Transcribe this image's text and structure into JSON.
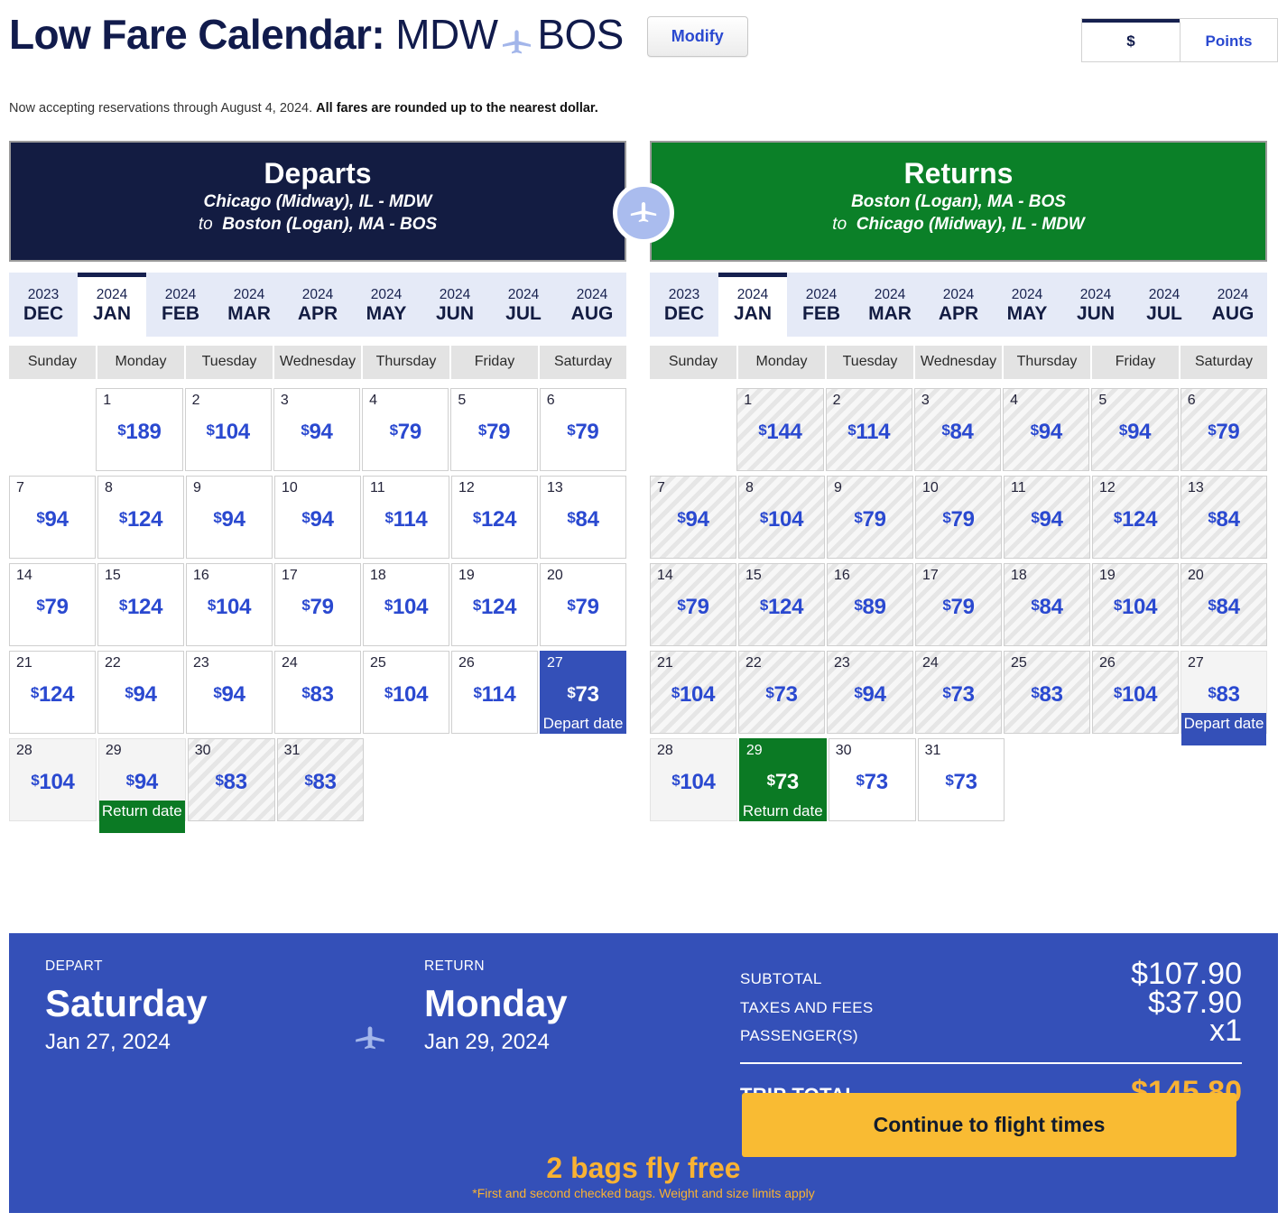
{
  "header": {
    "title_prefix": "Low Fare Calendar:",
    "origin_code": "MDW",
    "dest_code": "BOS",
    "plane_icon": "airplane-icon",
    "modify_label": "Modify",
    "currency_tabs": [
      {
        "label": "$",
        "active": true
      },
      {
        "label": "Points",
        "active": false
      }
    ],
    "note_plain": "Now accepting reservations through August 4, 2024.",
    "note_bold": "All fares are rounded up to the nearest dollar."
  },
  "colors": {
    "depart_navy": "#131c42",
    "return_green": "#0b8028",
    "fare_blue": "#2a49d0",
    "summary_blue": "#3450b8",
    "accent_gold": "#f9b233"
  },
  "departs": {
    "banner_title": "Departs",
    "banner_line1": "Chicago (Midway), IL - MDW",
    "banner_to": "to",
    "banner_line2": "Boston (Logan), MA - BOS",
    "months": [
      {
        "year": "2023",
        "month": "DEC",
        "active": false
      },
      {
        "year": "2024",
        "month": "JAN",
        "active": true
      },
      {
        "year": "2024",
        "month": "FEB",
        "active": false
      },
      {
        "year": "2024",
        "month": "MAR",
        "active": false
      },
      {
        "year": "2024",
        "month": "APR",
        "active": false
      },
      {
        "year": "2024",
        "month": "MAY",
        "active": false
      },
      {
        "year": "2024",
        "month": "JUN",
        "active": false
      },
      {
        "year": "2024",
        "month": "JUL",
        "active": false
      },
      {
        "year": "2024",
        "month": "AUG",
        "active": false
      }
    ],
    "weekdays": [
      "Sunday",
      "Monday",
      "Tuesday",
      "Wednesday",
      "Thursday",
      "Friday",
      "Saturday"
    ],
    "weeks": [
      [
        {
          "empty": true
        },
        {
          "day": "1",
          "fare": "189",
          "state": "normal"
        },
        {
          "day": "2",
          "fare": "104",
          "state": "normal"
        },
        {
          "day": "3",
          "fare": "94",
          "state": "normal"
        },
        {
          "day": "4",
          "fare": "79",
          "state": "normal"
        },
        {
          "day": "5",
          "fare": "79",
          "state": "normal"
        },
        {
          "day": "6",
          "fare": "79",
          "state": "normal"
        }
      ],
      [
        {
          "day": "7",
          "fare": "94",
          "state": "normal"
        },
        {
          "day": "8",
          "fare": "124",
          "state": "normal"
        },
        {
          "day": "9",
          "fare": "94",
          "state": "normal"
        },
        {
          "day": "10",
          "fare": "94",
          "state": "normal"
        },
        {
          "day": "11",
          "fare": "114",
          "state": "normal"
        },
        {
          "day": "12",
          "fare": "124",
          "state": "normal"
        },
        {
          "day": "13",
          "fare": "84",
          "state": "normal"
        }
      ],
      [
        {
          "day": "14",
          "fare": "79",
          "state": "normal"
        },
        {
          "day": "15",
          "fare": "124",
          "state": "normal"
        },
        {
          "day": "16",
          "fare": "104",
          "state": "normal"
        },
        {
          "day": "17",
          "fare": "79",
          "state": "normal"
        },
        {
          "day": "18",
          "fare": "104",
          "state": "normal"
        },
        {
          "day": "19",
          "fare": "124",
          "state": "normal"
        },
        {
          "day": "20",
          "fare": "79",
          "state": "normal"
        }
      ],
      [
        {
          "day": "21",
          "fare": "124",
          "state": "normal"
        },
        {
          "day": "22",
          "fare": "94",
          "state": "normal"
        },
        {
          "day": "23",
          "fare": "94",
          "state": "normal"
        },
        {
          "day": "24",
          "fare": "83",
          "state": "normal"
        },
        {
          "day": "25",
          "fare": "104",
          "state": "normal"
        },
        {
          "day": "26",
          "fare": "114",
          "state": "normal"
        },
        {
          "day": "27",
          "fare": "73",
          "state": "selected-depart",
          "badge": "Depart date"
        }
      ],
      [
        {
          "day": "28",
          "fare": "104",
          "state": "dim"
        },
        {
          "day": "29",
          "fare": "94",
          "state": "dim",
          "badge": "Return date",
          "badge_kind": "return"
        },
        {
          "day": "30",
          "fare": "83",
          "state": "hatch"
        },
        {
          "day": "31",
          "fare": "83",
          "state": "hatch"
        },
        {
          "empty": true
        },
        {
          "empty": true
        },
        {
          "empty": true
        }
      ]
    ]
  },
  "returns": {
    "banner_title": "Returns",
    "banner_line1": "Boston (Logan), MA - BOS",
    "banner_to": "to",
    "banner_line2": "Chicago (Midway), IL - MDW",
    "months": [
      {
        "year": "2023",
        "month": "DEC",
        "active": false
      },
      {
        "year": "2024",
        "month": "JAN",
        "active": true
      },
      {
        "year": "2024",
        "month": "FEB",
        "active": false
      },
      {
        "year": "2024",
        "month": "MAR",
        "active": false
      },
      {
        "year": "2024",
        "month": "APR",
        "active": false
      },
      {
        "year": "2024",
        "month": "MAY",
        "active": false
      },
      {
        "year": "2024",
        "month": "JUN",
        "active": false
      },
      {
        "year": "2024",
        "month": "JUL",
        "active": false
      },
      {
        "year": "2024",
        "month": "AUG",
        "active": false
      }
    ],
    "weekdays": [
      "Sunday",
      "Monday",
      "Tuesday",
      "Wednesday",
      "Thursday",
      "Friday",
      "Saturday"
    ],
    "weeks": [
      [
        {
          "empty": true
        },
        {
          "day": "1",
          "fare": "144",
          "state": "hatch"
        },
        {
          "day": "2",
          "fare": "114",
          "state": "hatch"
        },
        {
          "day": "3",
          "fare": "84",
          "state": "hatch"
        },
        {
          "day": "4",
          "fare": "94",
          "state": "hatch"
        },
        {
          "day": "5",
          "fare": "94",
          "state": "hatch"
        },
        {
          "day": "6",
          "fare": "79",
          "state": "hatch"
        }
      ],
      [
        {
          "day": "7",
          "fare": "94",
          "state": "hatch"
        },
        {
          "day": "8",
          "fare": "104",
          "state": "hatch"
        },
        {
          "day": "9",
          "fare": "79",
          "state": "hatch"
        },
        {
          "day": "10",
          "fare": "79",
          "state": "hatch"
        },
        {
          "day": "11",
          "fare": "94",
          "state": "hatch"
        },
        {
          "day": "12",
          "fare": "124",
          "state": "hatch"
        },
        {
          "day": "13",
          "fare": "84",
          "state": "hatch"
        }
      ],
      [
        {
          "day": "14",
          "fare": "79",
          "state": "hatch"
        },
        {
          "day": "15",
          "fare": "124",
          "state": "hatch"
        },
        {
          "day": "16",
          "fare": "89",
          "state": "hatch"
        },
        {
          "day": "17",
          "fare": "79",
          "state": "hatch"
        },
        {
          "day": "18",
          "fare": "84",
          "state": "hatch"
        },
        {
          "day": "19",
          "fare": "104",
          "state": "hatch"
        },
        {
          "day": "20",
          "fare": "84",
          "state": "hatch"
        }
      ],
      [
        {
          "day": "21",
          "fare": "104",
          "state": "hatch"
        },
        {
          "day": "22",
          "fare": "73",
          "state": "hatch"
        },
        {
          "day": "23",
          "fare": "94",
          "state": "hatch"
        },
        {
          "day": "24",
          "fare": "73",
          "state": "hatch"
        },
        {
          "day": "25",
          "fare": "83",
          "state": "hatch"
        },
        {
          "day": "26",
          "fare": "104",
          "state": "hatch"
        },
        {
          "day": "27",
          "fare": "83",
          "state": "dim",
          "badge": "Depart date",
          "badge_kind": "depart"
        }
      ],
      [
        {
          "day": "28",
          "fare": "104",
          "state": "dim"
        },
        {
          "day": "29",
          "fare": "73",
          "state": "selected-return",
          "badge": "Return date"
        },
        {
          "day": "30",
          "fare": "73",
          "state": "normal"
        },
        {
          "day": "31",
          "fare": "73",
          "state": "normal"
        },
        {
          "empty": true
        },
        {
          "empty": true
        },
        {
          "empty": true
        }
      ]
    ]
  },
  "summary": {
    "depart_label": "DEPART",
    "depart_day": "Saturday",
    "depart_date": "Jan 27, 2024",
    "return_label": "RETURN",
    "return_day": "Monday",
    "return_date": "Jan 29, 2024",
    "plane_icon": "airplane-icon",
    "prices": [
      {
        "label": "SUBTOTAL",
        "value": "$107.90"
      },
      {
        "label": "TAXES AND FEES",
        "value": "$37.90"
      },
      {
        "label": "PASSENGER(S)",
        "value": "x1"
      }
    ],
    "total_label": "TRIP TOTAL",
    "total_value": "$145.80",
    "bags_headline": "2 bags fly free",
    "bags_fine": "*First and second checked bags. Weight and size limits apply",
    "continue_label": "Continue to flight times"
  }
}
